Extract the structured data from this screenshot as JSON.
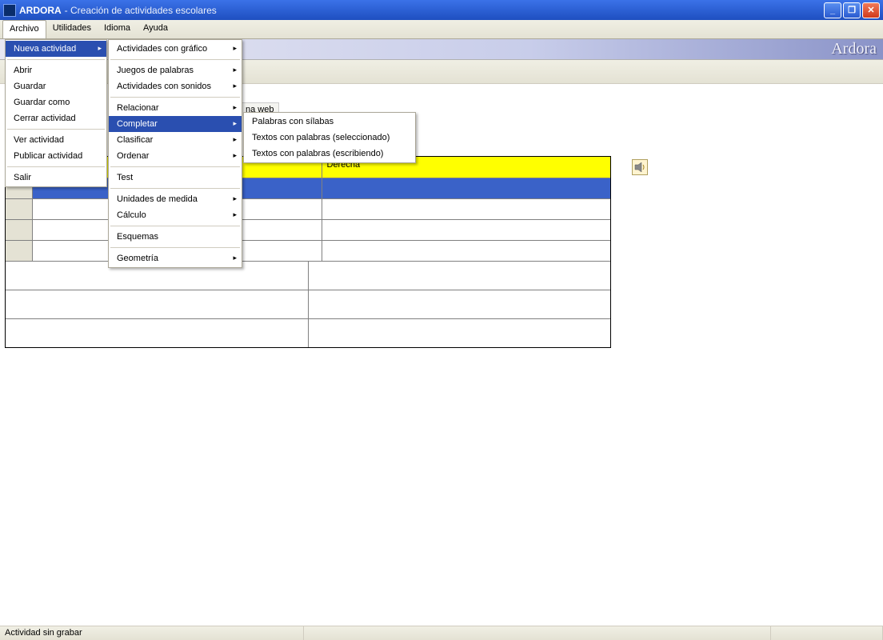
{
  "window": {
    "app": "ARDORA",
    "subtitle": "- Creación de actividades escolares",
    "buttons": {
      "min": "_",
      "max": "❐",
      "close": "✕"
    }
  },
  "menubar": [
    "Archivo",
    "Utilidades",
    "Idioma",
    "Ayuda"
  ],
  "brand": "Ardora",
  "archivo_menu": {
    "nueva": "Nueva actividad",
    "abrir": "Abrir",
    "guardar": "Guardar",
    "guardar_como": "Guardar como",
    "cerrar": "Cerrar actividad",
    "ver": "Ver actividad",
    "publicar": "Publicar actividad",
    "salir": "Salir"
  },
  "nueva_submenu": {
    "grafico": "Actividades con gráfico",
    "juegos": "Juegos de palabras",
    "sonidos": "Actividades con sonidos",
    "relacionar": "Relacionar",
    "completar": "Completar",
    "clasificar": "Clasificar",
    "ordenar": "Ordenar",
    "test": "Test",
    "unidades": "Unidades de medida",
    "calculo": "Cálculo",
    "esquemas": "Esquemas",
    "geometria": "Geometría"
  },
  "completar_submenu": {
    "silabas": "Palabras con sílabas",
    "seleccionado": "Textos con palabras (seleccionado)",
    "escribiendo": "Textos con palabras (escribiendo)"
  },
  "tab_hint": "na web",
  "grid": {
    "header_left": "",
    "header_right": "Derecha"
  },
  "status": "Actividad sin grabar"
}
